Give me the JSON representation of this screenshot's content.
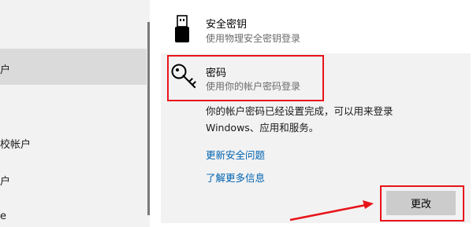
{
  "sidebar": {
    "items": [
      {
        "label": "户"
      },
      {
        "label": "校帐户"
      },
      {
        "label": "户"
      },
      {
        "label": "e"
      }
    ]
  },
  "options": {
    "security_key": {
      "title": "安全密钥",
      "subtitle": "使用物理安全密钥登录",
      "icon": "usb-key-icon"
    },
    "password": {
      "title": "密码",
      "subtitle": "使用你的帐户密码登录",
      "icon": "key-icon",
      "description_line1": "你的帐户密码已经设置完成，可以用来登录",
      "description_line2": "Windows、应用和服务。",
      "link_security_questions": "更新安全问题",
      "link_learn_more": "了解更多信息",
      "change_button": "更改"
    }
  },
  "annotations": {
    "highlight_color": "#e8141a",
    "arrow_color": "#e8141a"
  },
  "colors": {
    "link": "#0063b1",
    "selected_sidebar": "#dadada",
    "panel_bg": "#f2f2f2",
    "button_bg": "#cccccc"
  }
}
